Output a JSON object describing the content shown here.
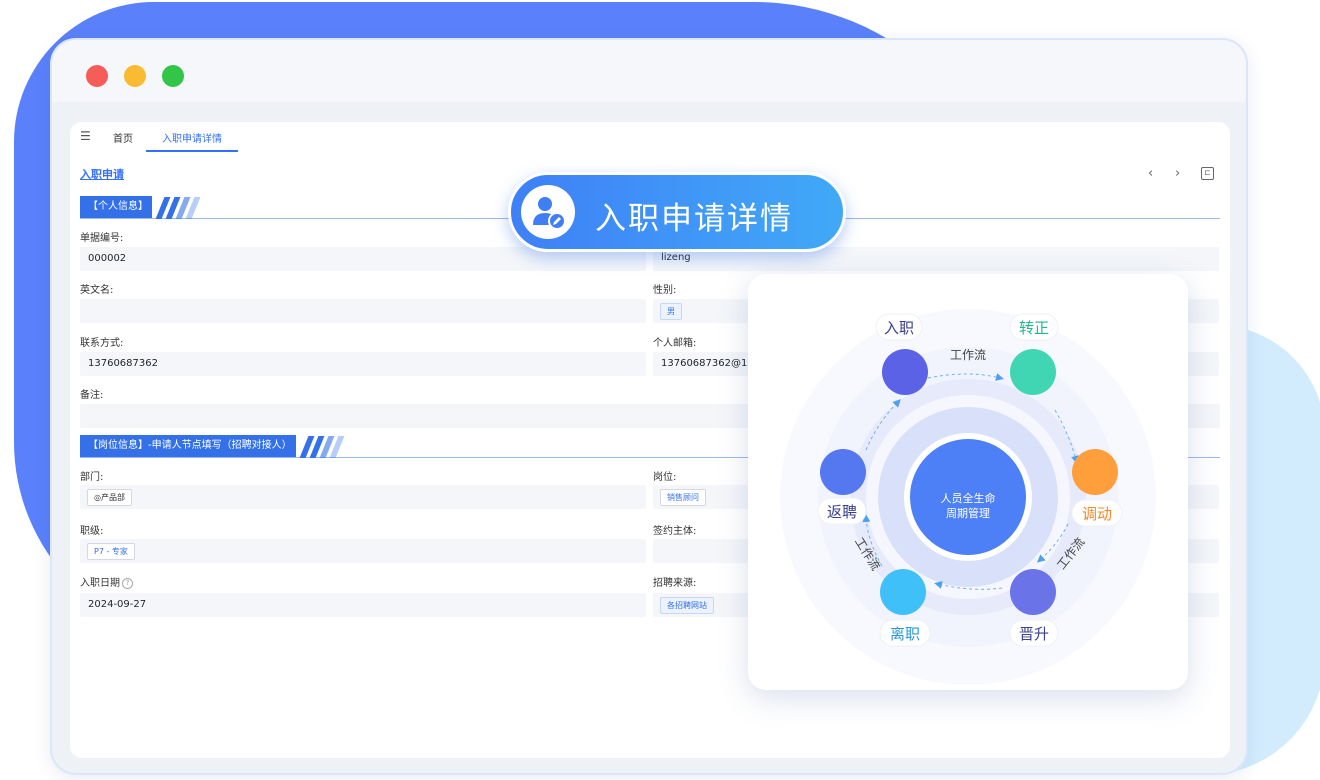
{
  "tabs": {
    "home": "首页",
    "active": "入职申请详情"
  },
  "page_title": "入职申请",
  "banner": {
    "title": "入职申请详情"
  },
  "sections": {
    "personal": "【个人信息】",
    "position": "【岗位信息】-申请人节点填写（招聘对接人）"
  },
  "fields": {
    "doc_no_label": "单据编号:",
    "doc_no": "000002",
    "name_value": "lizeng",
    "english_name_label": "英文名:",
    "gender_label": "性别:",
    "gender": "男",
    "contact_label": "联系方式:",
    "contact": "13760687362",
    "email_label": "个人邮箱:",
    "email": "13760687362@16",
    "remark_label": "备注:",
    "dept_label": "部门:",
    "dept": "◎产品部",
    "post_label": "岗位:",
    "post": "销售顾问",
    "level_label": "职级:",
    "level": "P7 - 专家",
    "subject_label": "签约主体:",
    "join_date_label": "入职日期",
    "join_date": "2024-09-27",
    "source_label": "招聘来源:",
    "source": "各招聘网站"
  },
  "diagram": {
    "center": [
      "人员全生命",
      "周期管理"
    ],
    "workflow": "工作流",
    "nodes": [
      {
        "label": "入职",
        "color": "#5b62e6",
        "label_color": "#3a3f8f"
      },
      {
        "label": "转正",
        "color": "#40d6b4",
        "label_color": "#20b890"
      },
      {
        "label": "调动",
        "color": "#fe9f3c",
        "label_color": "#f08a2a"
      },
      {
        "label": "晋升",
        "color": "#6a74e8",
        "label_color": "#3a3f8f"
      },
      {
        "label": "离职",
        "color": "#40c0f8",
        "label_color": "#2a9ad8"
      },
      {
        "label": "返聘",
        "color": "#5577f0",
        "label_color": "#3a3f8f"
      }
    ]
  }
}
